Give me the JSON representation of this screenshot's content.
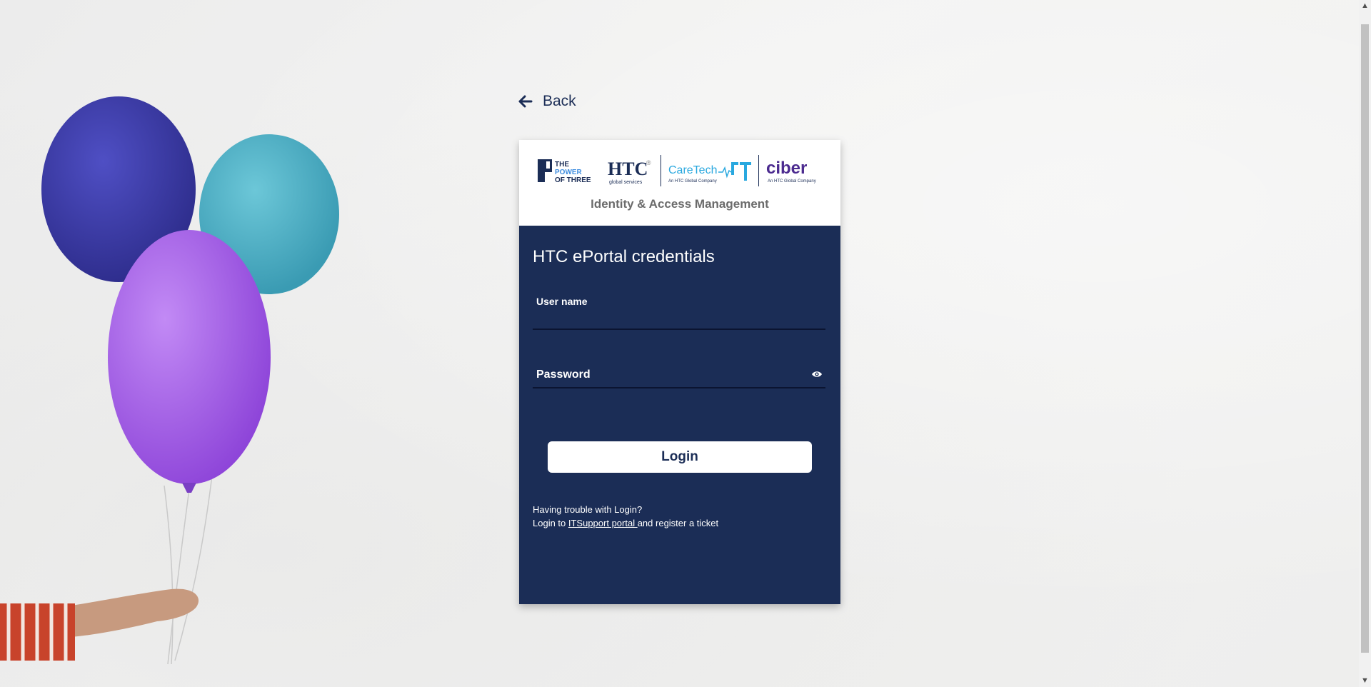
{
  "back": {
    "label": "Back"
  },
  "header": {
    "logos": {
      "power_of_three": [
        "THE",
        "POWER",
        "OF THREE"
      ],
      "htc": {
        "name": "HTC",
        "tagline": "global services",
        "mark": "®"
      },
      "caretech": {
        "name": "CareTech",
        "sub": "An HTC Global Company"
      },
      "ciber": {
        "name": "ciber",
        "sub": "An HTC Global Company"
      }
    },
    "title": "Identity & Access Management"
  },
  "form": {
    "heading": "HTC ePortal credentials",
    "username_label": "User name",
    "password_label": "Password",
    "login_label": "Login"
  },
  "help": {
    "line1": "Having trouble with Login?",
    "prefix": "Login to ",
    "link": "ITSupport portal ",
    "suffix": "and register a ticket"
  },
  "colors": {
    "panel": "#1b2d56",
    "header_text": "#6b6b6b",
    "balloon_blue": "#3b3aa8",
    "balloon_teal": "#4fb3c9",
    "balloon_purple": "#a05ee6"
  }
}
